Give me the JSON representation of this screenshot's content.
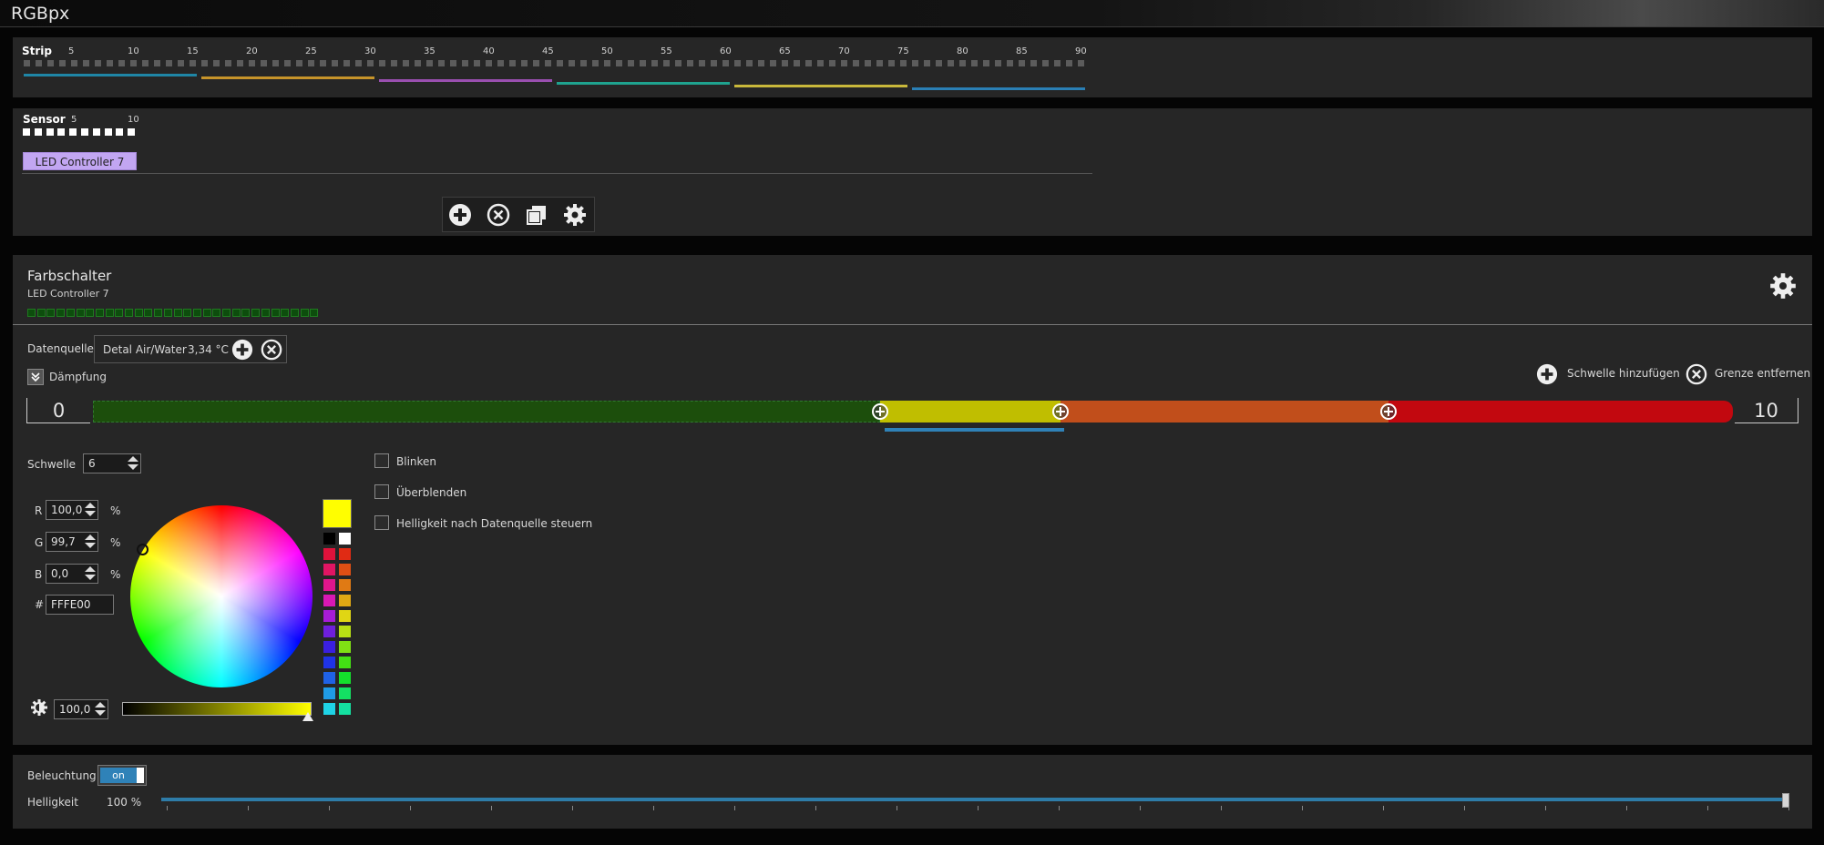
{
  "app": {
    "title": "RGBpx"
  },
  "strip": {
    "label": "Strip",
    "ticks": [
      "5",
      "10",
      "15",
      "20",
      "25",
      "30",
      "35",
      "40",
      "45",
      "50",
      "55",
      "60",
      "65",
      "70",
      "75",
      "80",
      "85",
      "90"
    ],
    "led_count": 90,
    "segment_colors": [
      "#1f86a6",
      "#c7942a",
      "#9a4fb0",
      "#1fa38f",
      "#c9b83b",
      "#2a7fb5"
    ]
  },
  "sensor": {
    "label": "Sensor",
    "ticks": [
      "5",
      "10"
    ],
    "count": 10,
    "controller_tag": "LED Controller 7",
    "toolbar": [
      "add-icon",
      "remove-icon",
      "copy-icon",
      "settings-icon"
    ]
  },
  "main": {
    "title": "Farbschalter",
    "subtitle": "LED Controller 7",
    "led_count": 30,
    "datasource_label": "Datenquelle",
    "datasource_name": "Detal Air/Water",
    "datasource_value": "3,34 °C",
    "damping_label": "Dämpfung",
    "add_threshold": "Schwelle hinzufügen",
    "remove_limit": "Grenze entfernen",
    "range_min": "0",
    "range_max": "10",
    "segments": [
      {
        "color": "#1c4e0c",
        "from": 0,
        "to": 4.8
      },
      {
        "color": "#c0be00",
        "from": 4.8,
        "to": 5.9
      },
      {
        "color": "#c14e1b",
        "from": 5.9,
        "to": 7.9
      },
      {
        "color": "#c2080f",
        "from": 7.9,
        "to": 10
      }
    ],
    "threshold_label": "Schwelle",
    "threshold_value": "6",
    "r_label": "R",
    "r_value": "100,0",
    "g_label": "G",
    "g_value": "99,7",
    "b_label": "B",
    "b_value": "0,0",
    "percent": "%",
    "hex_label": "#",
    "hex_value": "FFFE00",
    "brightness_value": "100,0",
    "current_color": "#fffe00",
    "checkboxes": [
      "Blinken",
      "Überblenden",
      "Helligkeit nach Datenquelle steuern"
    ],
    "palette_left": [
      "#000000",
      "#e0123b",
      "#e01563",
      "#e0168c",
      "#d918b4",
      "#a61cd6",
      "#6f1fdb",
      "#3a1fe0",
      "#1f33e6",
      "#1f62e6",
      "#1f9be6",
      "#1fd3e6"
    ],
    "palette_right": [
      "#ffffff",
      "#e02b14",
      "#e04f14",
      "#e07a14",
      "#e0a814",
      "#e0d614",
      "#b8e014",
      "#80e014",
      "#43e014",
      "#14e02c",
      "#14e063",
      "#14e0a0"
    ]
  },
  "bottom": {
    "lighting_label": "Beleuchtung",
    "toggle_text": "on",
    "brightness_label": "Helligkeit",
    "brightness_value": "100 %",
    "brightness_level": 1.0
  }
}
